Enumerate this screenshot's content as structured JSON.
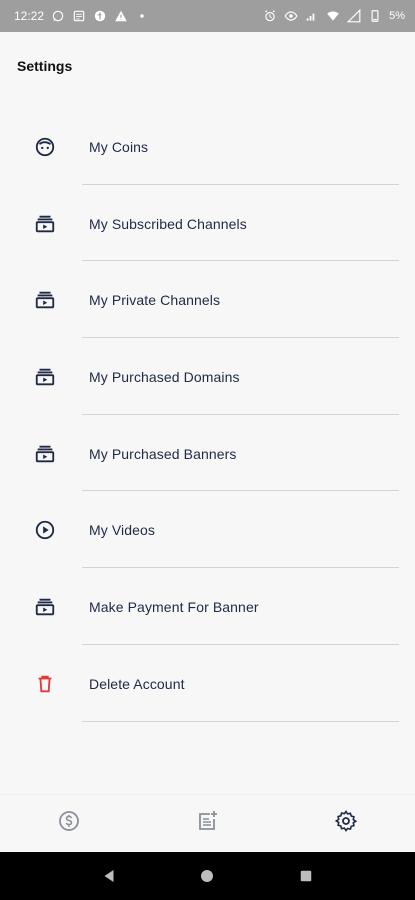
{
  "status_bar": {
    "time": "12:22",
    "battery": "5%",
    "left_icons": [
      "whatsapp-icon",
      "news-icon",
      "app-icon",
      "warning-icon",
      "dot-icon"
    ],
    "right_icons": [
      "alarm-icon",
      "eye-icon",
      "signal-lte-icon",
      "wifi-icon",
      "cell-signal-icon",
      "battery-icon"
    ]
  },
  "page": {
    "title": "Settings"
  },
  "settings_items": [
    {
      "label": "My Coins",
      "icon": "coin-face-icon"
    },
    {
      "label": "My Subscribed Channels",
      "icon": "channel-stack-icon"
    },
    {
      "label": "My Private Channels",
      "icon": "channel-stack-icon"
    },
    {
      "label": "My Purchased Domains",
      "icon": "channel-stack-icon"
    },
    {
      "label": "My Purchased Banners",
      "icon": "channel-stack-icon"
    },
    {
      "label": "My Videos",
      "icon": "play-circle-icon"
    },
    {
      "label": "Make Payment For Banner",
      "icon": "channel-stack-icon"
    },
    {
      "label": "Delete Account",
      "icon": "trash-icon"
    }
  ],
  "bottom_nav": {
    "items": [
      {
        "icon": "dollar-coin-icon",
        "active": false
      },
      {
        "icon": "post-add-icon",
        "active": false
      },
      {
        "icon": "gear-icon",
        "active": true
      }
    ]
  },
  "colors": {
    "primary": "#1e2a44",
    "danger": "#e53935",
    "inactive": "#8a8f98",
    "divider": "#cfd3da",
    "background": "#f7f7f8"
  }
}
